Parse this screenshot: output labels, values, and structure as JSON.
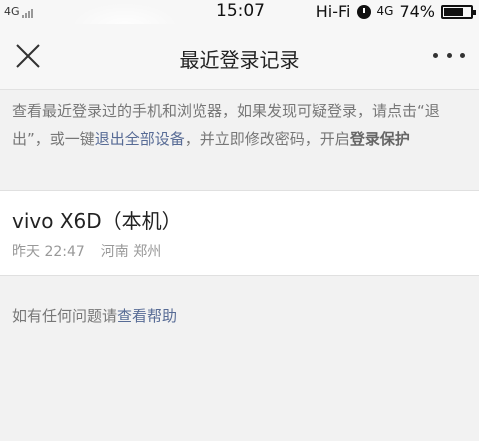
{
  "status_bar": {
    "network_left": "4G",
    "time": "15:07",
    "wifi": "Hi-Fi",
    "network_right": "4G",
    "battery": "74%",
    "battery_level": 0.74
  },
  "nav": {
    "title": "最近登录记录"
  },
  "notice": {
    "text_1": "查看最近登录过的手机和浏览器，如果发现可疑登录，请点击“退出”，或一键",
    "link_logout_all": "退出全部设备",
    "text_2": "，并立即修改密码，开启",
    "link_login_protect": "登录保护"
  },
  "devices": [
    {
      "name": "vivo X6D（本机）",
      "time": "昨天 22:47",
      "location": "河南 郑州"
    }
  ],
  "help": {
    "text": "如有任何问题请",
    "link": "查看帮助"
  }
}
